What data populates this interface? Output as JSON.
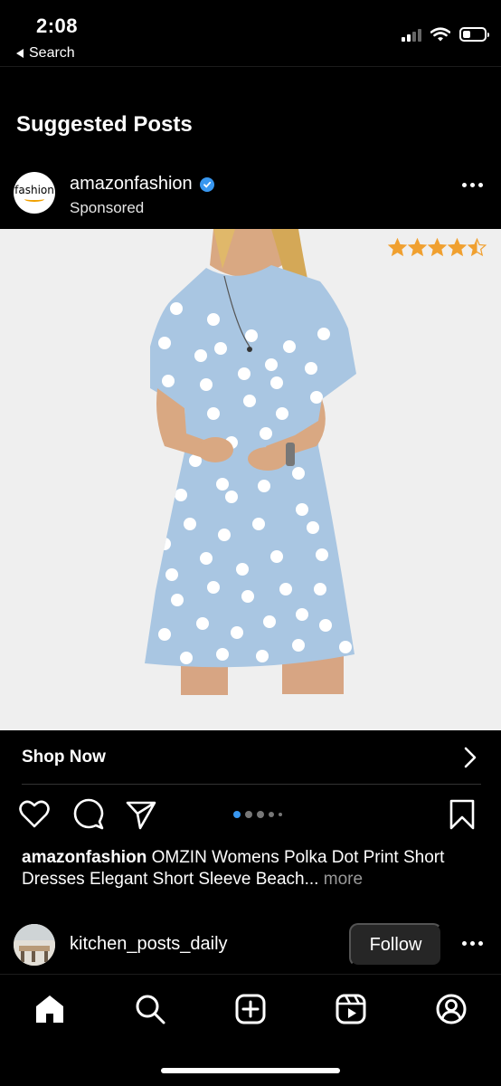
{
  "status_bar": {
    "time": "2:08",
    "back_app_label": "Search",
    "battery_level": 0.35,
    "signal_bars": 2
  },
  "feed": {
    "section_title": "Suggested Posts"
  },
  "post": {
    "username": "amazonfashion",
    "subtitle": "Sponsored",
    "avatar_wordmark": "fashion",
    "verified": true,
    "rating": 4.5,
    "cta_label": "Shop Now",
    "carousel": {
      "count": 5,
      "active_index": 0
    },
    "caption": {
      "username": "amazonfashion",
      "text": "OMZIN Womens Polka Dot Print Short Dresses Elegant Short Sleeve Beach...",
      "more_label": "more"
    }
  },
  "next_post": {
    "username": "kitchen_posts_daily",
    "follow_label": "Follow"
  },
  "colors": {
    "background": "#000000",
    "accent_blue": "#3897f0",
    "star": "#f0a030",
    "dress": "#a9c6e2",
    "follow_button": "#262626"
  },
  "icons": {
    "post_actions": [
      "heart-icon",
      "comment-icon",
      "share-icon",
      "bookmark-icon"
    ],
    "bottom_nav": [
      "home-icon",
      "search-icon",
      "create-icon",
      "reels-icon",
      "profile-icon"
    ]
  }
}
